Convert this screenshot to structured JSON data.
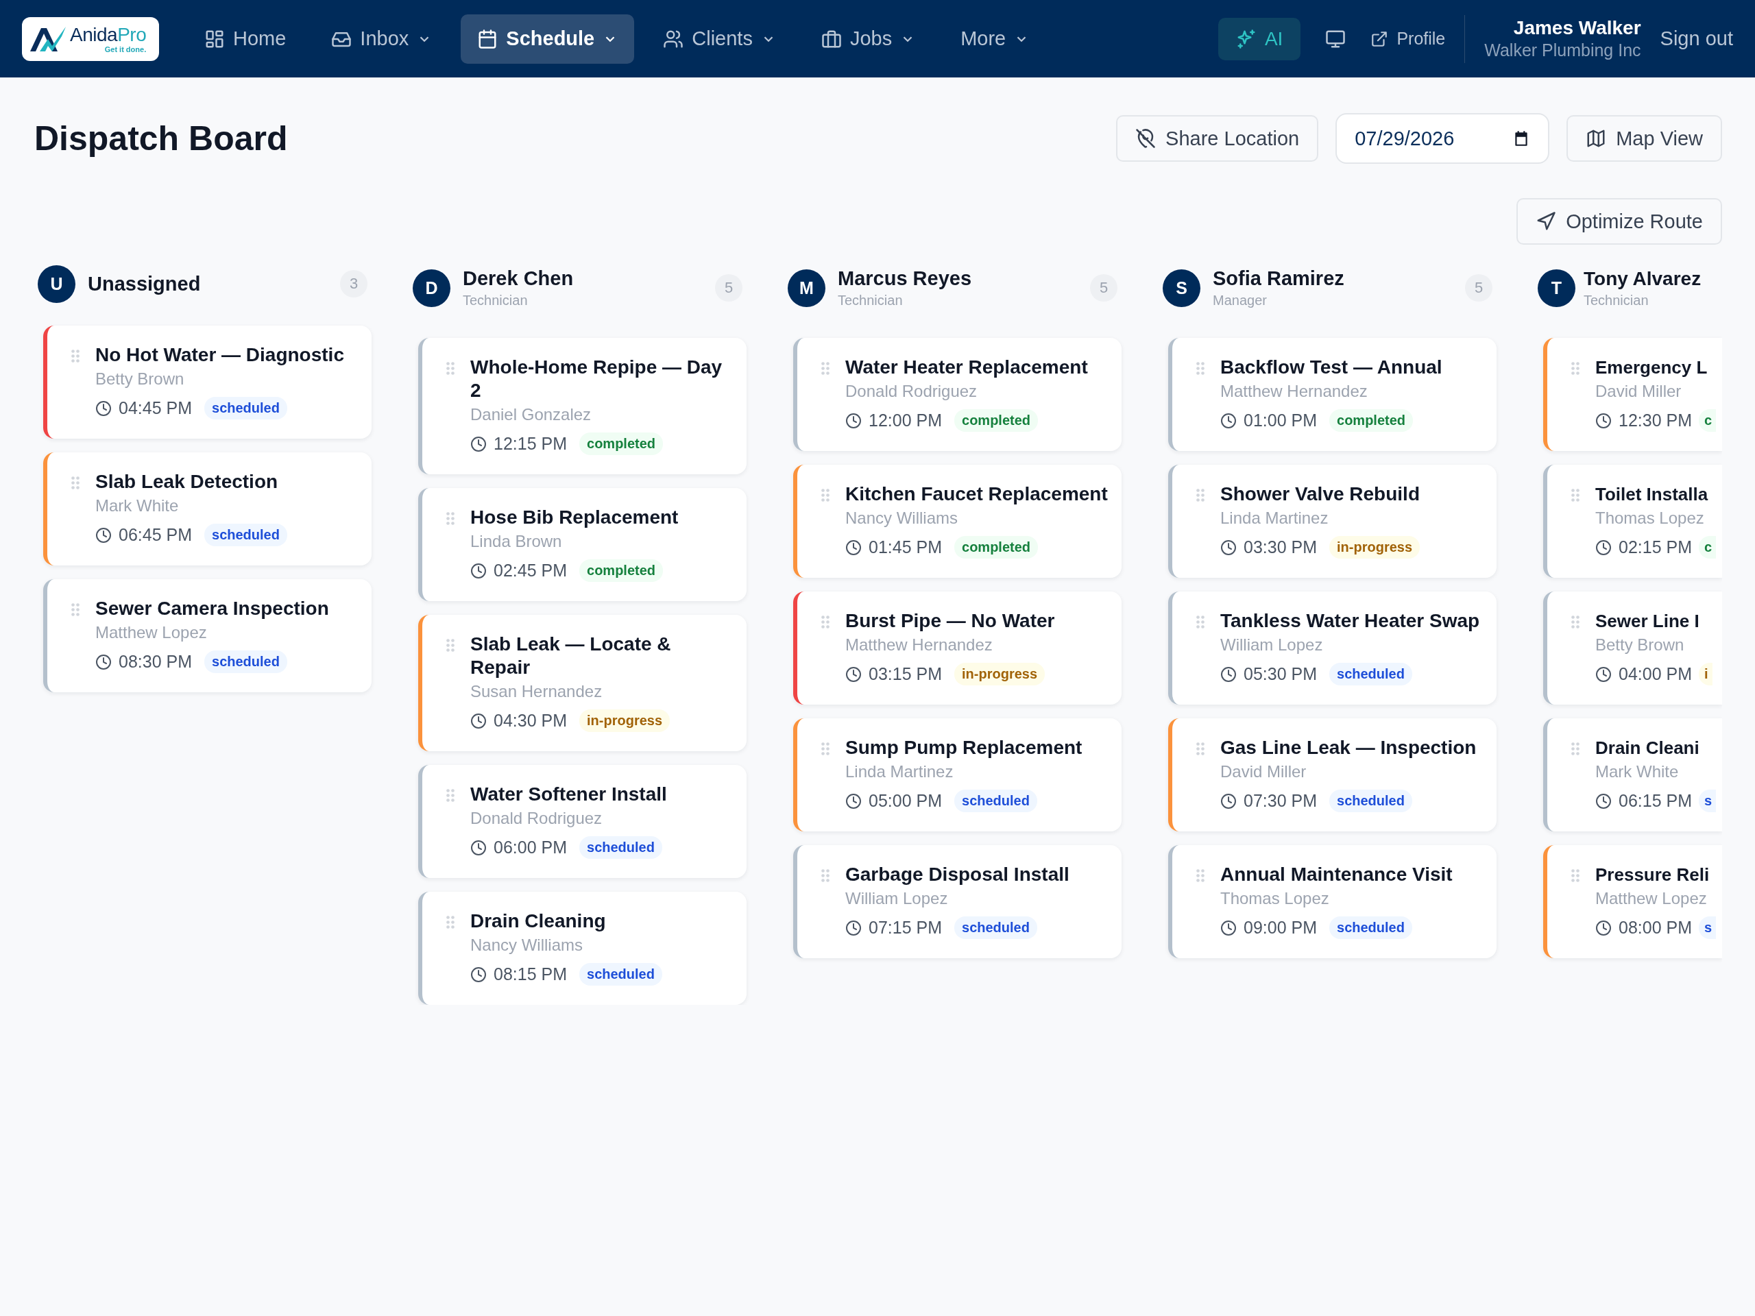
{
  "logo": {
    "name": "Anida",
    "name_accent": "Pro",
    "tagline": "Get it done."
  },
  "nav": [
    {
      "label": "Home",
      "dropdown": false,
      "selected": false
    },
    {
      "label": "Inbox",
      "dropdown": true,
      "selected": false
    },
    {
      "label": "Schedule",
      "dropdown": true,
      "selected": true
    },
    {
      "label": "Clients",
      "dropdown": true,
      "selected": false
    },
    {
      "label": "Jobs",
      "dropdown": true,
      "selected": false
    },
    {
      "label": "More",
      "dropdown": true,
      "selected": false
    }
  ],
  "ai_button": "AI",
  "profile_link": "Profile",
  "user": {
    "name": "James Walker",
    "company": "Walker Plumbing Inc"
  },
  "sign_out": "Sign out",
  "page_title": "Dispatch Board",
  "share_location": "Share Location",
  "date": "07/29/2026",
  "map_view": "Map View",
  "optimize_route": "Optimize Route",
  "columns": [
    {
      "initial": "U",
      "name": "Unassigned",
      "count": "3",
      "jobs": [
        {
          "title": "No Hot Water — Diagnostic",
          "customer": "Betty Brown",
          "time": "04:45 PM",
          "status": "scheduled",
          "kind": "scheduled",
          "color": "#ef4444"
        },
        {
          "title": "Slab Leak Detection",
          "customer": "Mark White",
          "time": "06:45 PM",
          "status": "scheduled",
          "kind": "scheduled",
          "color": "#fb923c"
        },
        {
          "title": "Sewer Camera Inspection",
          "customer": "Matthew Lopez",
          "time": "08:30 PM",
          "status": "scheduled",
          "kind": "scheduled",
          "color": "#b4c0cc"
        }
      ]
    },
    {
      "initial": "D",
      "name": "Derek Chen",
      "role": "Technician",
      "count": "5",
      "jobs": [
        {
          "title": "Whole-Home Repipe — Day 2",
          "customer": "Daniel Gonzalez",
          "time": "12:15 PM",
          "status": "completed",
          "kind": "completed",
          "color": "#b4c0cc"
        },
        {
          "title": "Hose Bib Replacement",
          "customer": "Linda Brown",
          "time": "02:45 PM",
          "status": "completed",
          "kind": "completed",
          "color": "#b4c0cc"
        },
        {
          "title": "Slab Leak — Locate & Repair",
          "customer": "Susan Hernandez",
          "time": "04:30 PM",
          "status": "in-progress",
          "kind": "in-progress",
          "color": "#fb923c"
        },
        {
          "title": "Water Softener Install",
          "customer": "Donald Rodriguez",
          "time": "06:00 PM",
          "status": "scheduled",
          "kind": "scheduled",
          "color": "#b4c0cc"
        },
        {
          "title": "Drain Cleaning",
          "customer": "Nancy Williams",
          "time": "08:15 PM",
          "status": "scheduled",
          "kind": "scheduled",
          "color": "#b4c0cc"
        }
      ]
    },
    {
      "initial": "M",
      "name": "Marcus Reyes",
      "role": "Technician",
      "count": "5",
      "jobs": [
        {
          "title": "Water Heater Replacement",
          "customer": "Donald Rodriguez",
          "time": "12:00 PM",
          "status": "completed",
          "kind": "completed",
          "color": "#b4c0cc"
        },
        {
          "title": "Kitchen Faucet Replacement",
          "customer": "Nancy Williams",
          "time": "01:45 PM",
          "status": "completed",
          "kind": "completed",
          "color": "#fb923c"
        },
        {
          "title": "Burst Pipe — No Water",
          "customer": "Matthew Hernandez",
          "time": "03:15 PM",
          "status": "in-progress",
          "kind": "in-progress",
          "color": "#ef4444"
        },
        {
          "title": "Sump Pump Replacement",
          "customer": "Linda Martinez",
          "time": "05:00 PM",
          "status": "scheduled",
          "kind": "scheduled",
          "color": "#fb923c"
        },
        {
          "title": "Garbage Disposal Install",
          "customer": "William Lopez",
          "time": "07:15 PM",
          "status": "scheduled",
          "kind": "scheduled",
          "color": "#b4c0cc"
        }
      ]
    },
    {
      "initial": "S",
      "name": "Sofia Ramirez",
      "role": "Manager",
      "count": "5",
      "jobs": [
        {
          "title": "Backflow Test — Annual",
          "customer": "Matthew Hernandez",
          "time": "01:00 PM",
          "status": "completed",
          "kind": "completed",
          "color": "#b4c0cc"
        },
        {
          "title": "Shower Valve Rebuild",
          "customer": "Linda Martinez",
          "time": "03:30 PM",
          "status": "in-progress",
          "kind": "in-progress",
          "color": "#b4c0cc"
        },
        {
          "title": "Tankless Water Heater Swap",
          "customer": "William Lopez",
          "time": "05:30 PM",
          "status": "scheduled",
          "kind": "scheduled",
          "color": "#b4c0cc"
        },
        {
          "title": "Gas Line Leak — Inspection",
          "customer": "David Miller",
          "time": "07:30 PM",
          "status": "scheduled",
          "kind": "scheduled",
          "color": "#fb923c"
        },
        {
          "title": "Annual Maintenance Visit",
          "customer": "Thomas Lopez",
          "time": "09:00 PM",
          "status": "scheduled",
          "kind": "scheduled",
          "color": "#b4c0cc"
        }
      ]
    },
    {
      "initial": "T",
      "name": "Tony Alvarez",
      "role": "Technician",
      "jobs": [
        {
          "title": "Emergency L",
          "customer": "David Miller",
          "time": "12:30 PM",
          "status": "c",
          "kind": "completed",
          "color": "#fb923c"
        },
        {
          "title": "Toilet Installa",
          "customer": "Thomas Lopez",
          "time": "02:15 PM",
          "status": "c",
          "kind": "completed",
          "color": "#b4c0cc"
        },
        {
          "title": "Sewer Line I",
          "customer": "Betty Brown",
          "time": "04:00 PM",
          "status": "i",
          "kind": "in-progress",
          "color": "#b4c0cc"
        },
        {
          "title": "Drain Cleani",
          "customer": "Mark White",
          "time": "06:15 PM",
          "status": "s",
          "kind": "scheduled",
          "color": "#b4c0cc"
        },
        {
          "title": "Pressure Reli",
          "customer": "Matthew Lopez",
          "time": "08:00 PM",
          "status": "s",
          "kind": "scheduled",
          "color": "#fb923c"
        }
      ]
    }
  ]
}
